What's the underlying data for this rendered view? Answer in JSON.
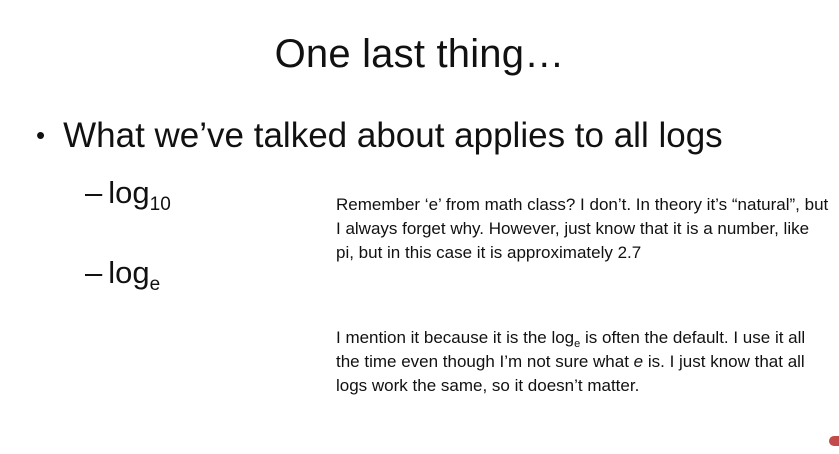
{
  "slide": {
    "title": "One last thing…",
    "bullet": "What we’ve talked about applies to all logs",
    "sub_items": [
      {
        "dash": "–",
        "base": "log",
        "subscript": "10"
      },
      {
        "dash": "–",
        "base": "log",
        "subscript": "e"
      }
    ],
    "note_1": "Remember ‘e’ from math class? I don’t. In theory it’s “natural”, but I always forget why. However, just know that it is a number, like pi, but in this case it is approximately 2.7",
    "note_2": {
      "before": "I mention it because it is the log",
      "subscript": "e",
      "middle": " is often the default. I use it all the time even though I’m not sure what ",
      "emphasis": "e",
      "after": " is. I just know that all logs work the same, so it doesn’t matter."
    }
  },
  "colors": {
    "background": "#ffffff",
    "text": "#111111",
    "corner_mark": "#c24a4a"
  },
  "icons": {
    "bullet": "bullet-dot",
    "corner": "record-indicator-icon"
  }
}
